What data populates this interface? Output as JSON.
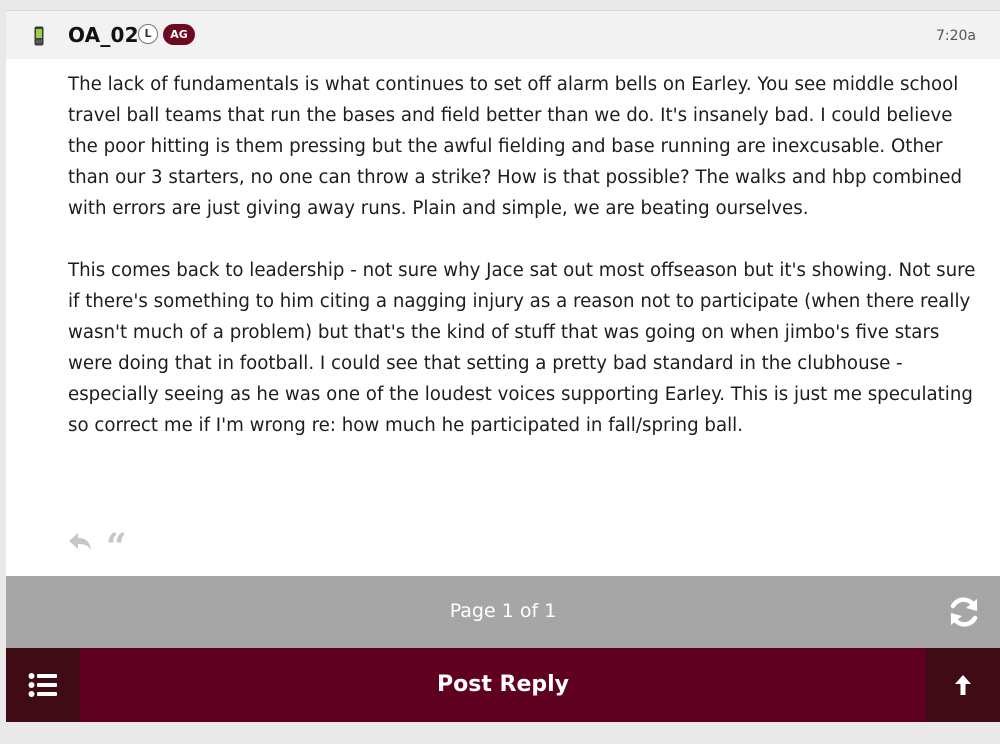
{
  "post": {
    "username": "OA_02",
    "badge_letter": "L",
    "badge_group": "AG",
    "time": "7:20a",
    "paragraphs": [
      "The lack of fundamentals is what continues to set off alarm bells on Earley. You see middle school travel ball teams that run the bases and field better than we do. It's insanely bad. I could believe the poor hitting is them pressing but the awful fielding and base running are inexcusable. Other than our 3 starters, no one can throw a strike? How is that possible? The walks and hbp combined with errors are just giving away runs. Plain and simple, we are beating ourselves.",
      "This comes back to leadership - not sure why Jace sat out most offseason but it's showing. Not sure if there's something to him citing a nagging injury as a reason not to participate (when there really wasn't much of a problem) but that's the kind of stuff that was going on when jimbo's five stars were doing that in football. I could see that setting a pretty bad standard in the clubhouse - especially seeing as he was one of the loudest voices supporting Earley. This is just me speculating so correct me if I'm wrong re: how much he participated in fall/spring ball."
    ],
    "icons": {
      "device": "mobile-phone-icon",
      "reply": "reply-icon",
      "quote": "quote-icon"
    },
    "quote_glyph": "“"
  },
  "pager": {
    "label": "Page 1 of 1",
    "refresh_icon": "refresh-icon"
  },
  "footer": {
    "post_reply_label": "Post Reply",
    "menu_icon": "list-menu-icon",
    "top_icon": "arrow-up-icon"
  },
  "colors": {
    "brand_maroon": "#5f0020",
    "dark_maroon": "#3f0c16",
    "badge_maroon": "#6d0a20",
    "pager_gray": "#a6a6a6"
  }
}
